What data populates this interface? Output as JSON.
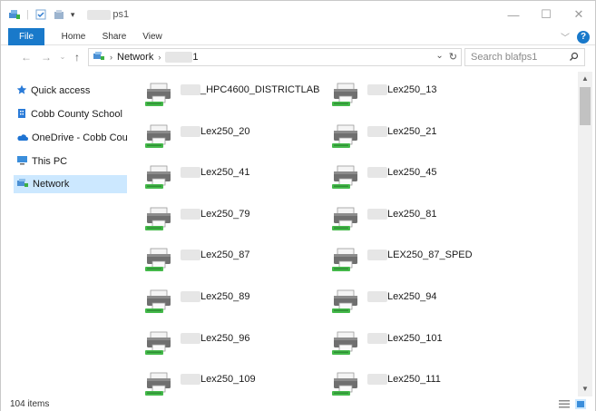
{
  "window": {
    "title_suffix": "ps1"
  },
  "ribbon": {
    "tabs": [
      "File",
      "Home",
      "Share",
      "View"
    ]
  },
  "address": {
    "crumb_network": "Network",
    "crumb_server_suffix": "1",
    "search_placeholder": "Search blafps1"
  },
  "navpane": {
    "items": [
      {
        "label": "Quick access",
        "icon": "star-icon"
      },
      {
        "label": "Cobb County School",
        "icon": "building-icon"
      },
      {
        "label": "OneDrive - Cobb Cou",
        "icon": "cloud-icon"
      },
      {
        "label": "This PC",
        "icon": "computer-icon"
      },
      {
        "label": "Network",
        "icon": "network-icon"
      }
    ],
    "selected": "Network"
  },
  "printers": [
    {
      "name": "_HPC4600_DISTRICTLAB"
    },
    {
      "name": "Lex250_13"
    },
    {
      "name": "Lex250_20"
    },
    {
      "name": "Lex250_21"
    },
    {
      "name": "Lex250_41"
    },
    {
      "name": "Lex250_45"
    },
    {
      "name": "Lex250_79"
    },
    {
      "name": "Lex250_81"
    },
    {
      "name": "Lex250_87"
    },
    {
      "name": "LEX250_87_SPED"
    },
    {
      "name": "Lex250_89"
    },
    {
      "name": "Lex250_94"
    },
    {
      "name": "Lex250_96"
    },
    {
      "name": "Lex250_101"
    },
    {
      "name": "Lex250_109"
    },
    {
      "name": "Lex250_111"
    }
  ],
  "status": {
    "items_count": "104 items"
  },
  "colors": {
    "accent": "#1979ca",
    "selected_bg": "#cce8ff"
  }
}
